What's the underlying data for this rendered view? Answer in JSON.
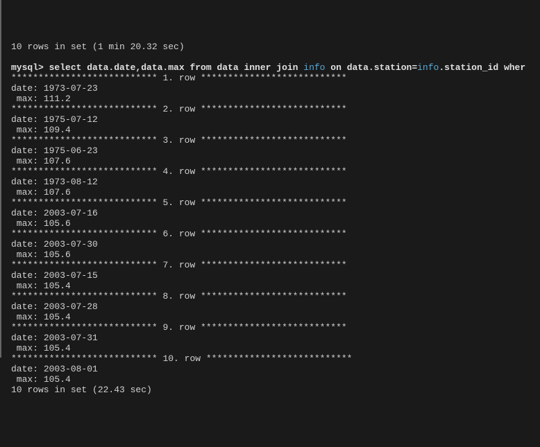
{
  "top_summary": "10 rows in set (1 min 20.32 sec)",
  "blank": "",
  "prompt_prefix": "mysql> ",
  "query_p1": "select data.date,data.max from data inner join ",
  "query_kw1": "info",
  "query_p2": " on data.station=",
  "query_kw2": "info",
  "query_p3": ".station_id wher",
  "rows": [
    {
      "sep_pre": "*************************** ",
      "sep_num": "1.",
      "sep_post": " row ***************************",
      "date_label": "date: ",
      "date": "1973-07-23",
      "max_label": " max: ",
      "max": "111.2"
    },
    {
      "sep_pre": "*************************** ",
      "sep_num": "2.",
      "sep_post": " row ***************************",
      "date_label": "date: ",
      "date": "1975-07-12",
      "max_label": " max: ",
      "max": "109.4"
    },
    {
      "sep_pre": "*************************** ",
      "sep_num": "3.",
      "sep_post": " row ***************************",
      "date_label": "date: ",
      "date": "1975-06-23",
      "max_label": " max: ",
      "max": "107.6"
    },
    {
      "sep_pre": "*************************** ",
      "sep_num": "4.",
      "sep_post": " row ***************************",
      "date_label": "date: ",
      "date": "1973-08-12",
      "max_label": " max: ",
      "max": "107.6"
    },
    {
      "sep_pre": "*************************** ",
      "sep_num": "5.",
      "sep_post": " row ***************************",
      "date_label": "date: ",
      "date": "2003-07-16",
      "max_label": " max: ",
      "max": "105.6"
    },
    {
      "sep_pre": "*************************** ",
      "sep_num": "6.",
      "sep_post": " row ***************************",
      "date_label": "date: ",
      "date": "2003-07-30",
      "max_label": " max: ",
      "max": "105.6"
    },
    {
      "sep_pre": "*************************** ",
      "sep_num": "7.",
      "sep_post": " row ***************************",
      "date_label": "date: ",
      "date": "2003-07-15",
      "max_label": " max: ",
      "max": "105.4"
    },
    {
      "sep_pre": "*************************** ",
      "sep_num": "8.",
      "sep_post": " row ***************************",
      "date_label": "date: ",
      "date": "2003-07-28",
      "max_label": " max: ",
      "max": "105.4"
    },
    {
      "sep_pre": "*************************** ",
      "sep_num": "9.",
      "sep_post": " row ***************************",
      "date_label": "date: ",
      "date": "2003-07-31",
      "max_label": " max: ",
      "max": "105.4"
    },
    {
      "sep_pre": "*************************** ",
      "sep_num": "10.",
      "sep_post": " row ***************************",
      "date_label": "date: ",
      "date": "2003-08-01",
      "max_label": " max: ",
      "max": "105.4"
    }
  ],
  "bottom_summary": "10 rows in set (22.43 sec)"
}
